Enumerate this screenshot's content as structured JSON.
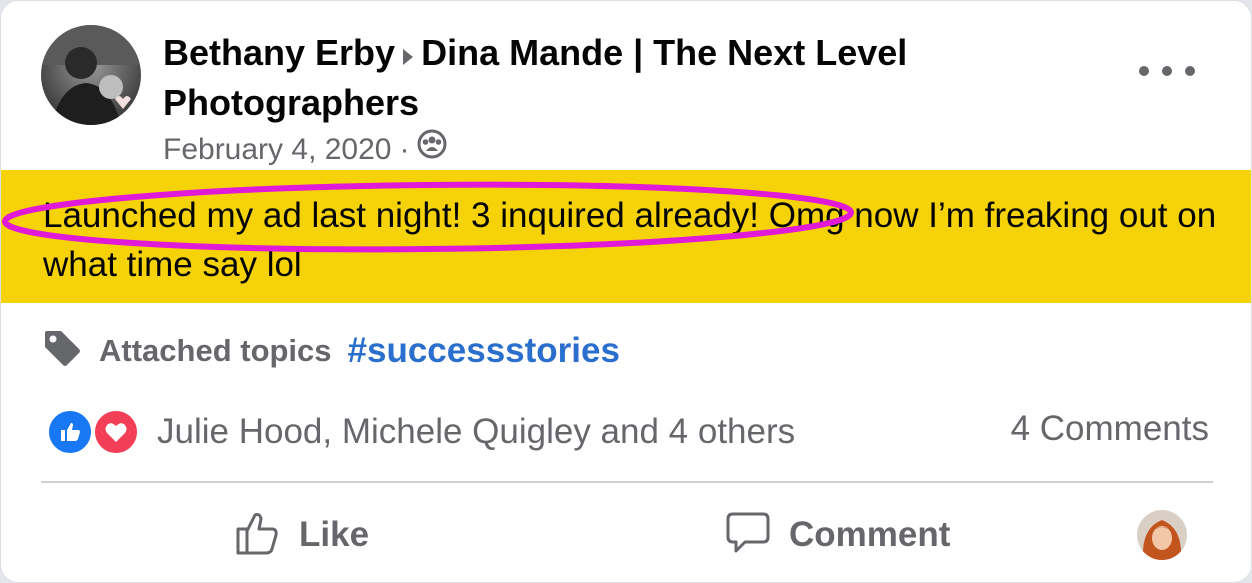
{
  "post": {
    "author": "Bethany Erby",
    "group": "Dina Mande | The Next Level Photographers",
    "date": "February 4, 2020",
    "separator": "·",
    "privacy_icon": "group-icon",
    "text": "Launched my ad last night! 3 inquired already!  Omg now I’m freaking out on what time say lol",
    "highlight_color": "#f6d208",
    "circle_color": "#e01ad6"
  },
  "topics": {
    "label": "Attached topics",
    "tag": "#successstories",
    "icon": "tag-icon"
  },
  "reactions": {
    "names": "Julie Hood, Michele Quigley and 4 others",
    "comments": "4 Comments",
    "icons": [
      "like-reaction-icon",
      "love-reaction-icon"
    ]
  },
  "actions": {
    "like": "Like",
    "comment": "Comment"
  },
  "colors": {
    "link": "#2a6fce",
    "secondary_text": "#65676b",
    "like_blue": "#1877f2",
    "love_red": "#f33e58"
  }
}
